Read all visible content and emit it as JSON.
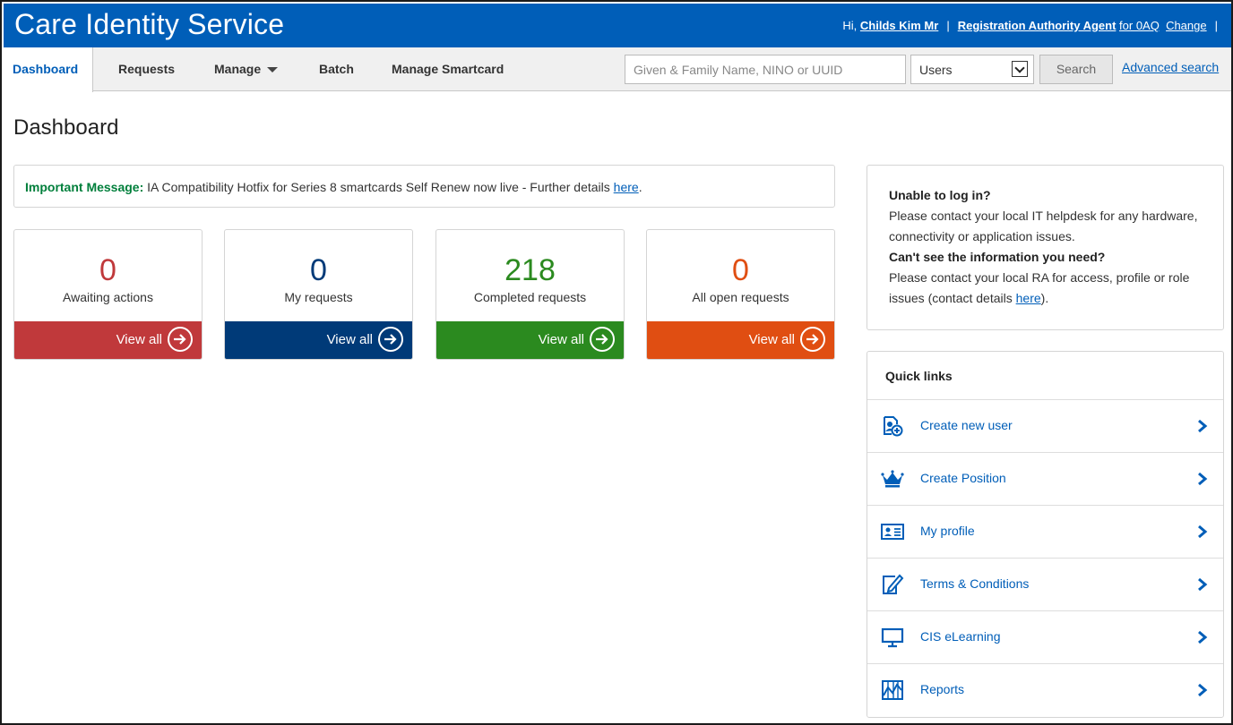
{
  "header": {
    "title": "Care Identity Service",
    "greeting": "Hi,",
    "user_name": "Childs Kim Mr",
    "separator": "|",
    "role": "Registration Authority Agent",
    "role_for": "for 0AQ",
    "change": "Change"
  },
  "nav": {
    "items": [
      {
        "label": "Dashboard"
      },
      {
        "label": "Requests"
      },
      {
        "label": "Manage"
      },
      {
        "label": "Batch"
      },
      {
        "label": "Manage Smartcard"
      }
    ],
    "search": {
      "placeholder": "Given & Family Name, NINO or UUID",
      "value": "",
      "type_selected": "Users",
      "button": "Search",
      "advanced": "Advanced search"
    }
  },
  "page": {
    "title": "Dashboard"
  },
  "message": {
    "label": "Important Message:",
    "text": " IA Compatibility Hotfix for Series 8 smartcards Self Renew now live - Further details ",
    "link": "here",
    "end": "."
  },
  "cards": [
    {
      "count": "0",
      "label": "Awaiting actions",
      "action": "View all",
      "color": "#c0393b",
      "num_color": "#c0393b"
    },
    {
      "count": "0",
      "label": "My requests",
      "action": "View all",
      "color": "#003a78",
      "num_color": "#003a78"
    },
    {
      "count": "218",
      "label": "Completed requests",
      "action": "View all",
      "color": "#2b8a1f",
      "num_color": "#2b8a1f"
    },
    {
      "count": "0",
      "label": "All open requests",
      "action": "View all",
      "color": "#e04e12",
      "num_color": "#e04e12"
    }
  ],
  "help": {
    "q1": "Unable to log in?",
    "a1": "Please contact your local IT helpdesk for any hardware, connectivity or application issues.",
    "q2": "Can't see the information you need?",
    "a2": "Please contact your local RA for access, profile or role issues (contact details ",
    "a2_link": "here",
    "a2_end": ")."
  },
  "quick_links": {
    "title": "Quick links",
    "items": [
      {
        "label": "Create new user",
        "icon": "create-user-icon"
      },
      {
        "label": "Create Position",
        "icon": "crown-icon"
      },
      {
        "label": "My profile",
        "icon": "id-card-icon"
      },
      {
        "label": "Terms & Conditions",
        "icon": "document-pen-icon"
      },
      {
        "label": "CIS eLearning",
        "icon": "monitor-icon"
      },
      {
        "label": "Reports",
        "icon": "chart-icon"
      }
    ]
  },
  "colors": {
    "brand": "#005eb8",
    "important": "#007f3b"
  }
}
